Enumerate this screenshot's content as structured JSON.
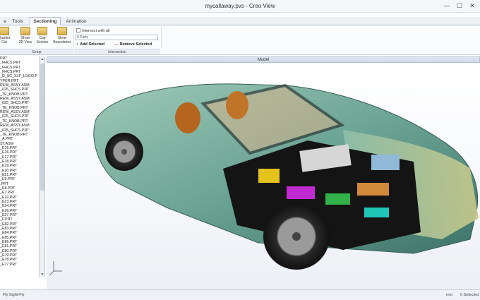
{
  "window": {
    "title": "mycallaway.pvs - Creo View",
    "minimize_label": "—",
    "maximize_label": "☐",
    "close_label": "✕"
  },
  "tabs": [
    {
      "label": "e"
    },
    {
      "label": "Tools"
    },
    {
      "label": "Sectioning"
    },
    {
      "label": "Animation"
    }
  ],
  "ribbon": {
    "buttons": [
      {
        "label": "Quarter\nCut"
      },
      {
        "label": "Show\n2D View"
      },
      {
        "label": "Cap\nSection"
      },
      {
        "label": "Show\nBoundaries"
      }
    ],
    "setup_group_label": "Setup",
    "intersect_label": "Intersect with all",
    "parts_value": "0 Parts",
    "add_selected_label": "Add Selected",
    "remove_selected_label": "Remove Selected",
    "intersection_group_label": "Intersection"
  },
  "tree_items": [
    "PRT",
    "_FHCS.PRT",
    "_FHCS.PRT",
    "_FHCS.PRT",
    "_D_SC_XLF_LOGO.P",
    "YPER.PRT",
    "REW_ASSY.ASM",
    "_625_SHCS.PRT",
    "_TE_KNOB.PRT",
    "REW_ASSY.ASM",
    "_625_SHCS.PRT",
    "_TE_KNOB.PRT",
    "REW_ASSY.ASM",
    "_625_SHCS.PRT",
    "_TE_KNOB.PRT",
    "REW_ASSY.ASM",
    "_625_SHCS.PRT",
    "_TE_KNOB.PRT",
    "_A.PRT",
    "ST.ASM",
    "_E15.PRT",
    "_E16.PRT",
    "_E17.PRT",
    "_E18.PRT",
    "_E19.PRT",
    "_E20.PRT",
    "_E21.PRT",
    "_E9.PRT",
    ".PRT",
    "_E8.PRT",
    "_E7.PRT",
    "_E22.PRT",
    "_E23.PRT",
    "_E24.PRT",
    "_E26.PRT",
    "_E27.PRT",
    "_F.PRT",
    "_E82.PRT",
    "_E83.PRT",
    "_E84.PRT",
    "_E85.PRT",
    "_E86.PRT",
    "_E81.PRT",
    "_E80.PRT",
    "_E79.PRT",
    "_E78.PRT",
    "_E77.PRT"
  ],
  "model_panel": {
    "title": "Model"
  },
  "status": {
    "left_text": "Fly   Sight-Fly",
    "units": "mm",
    "selected": "0 Selected"
  }
}
